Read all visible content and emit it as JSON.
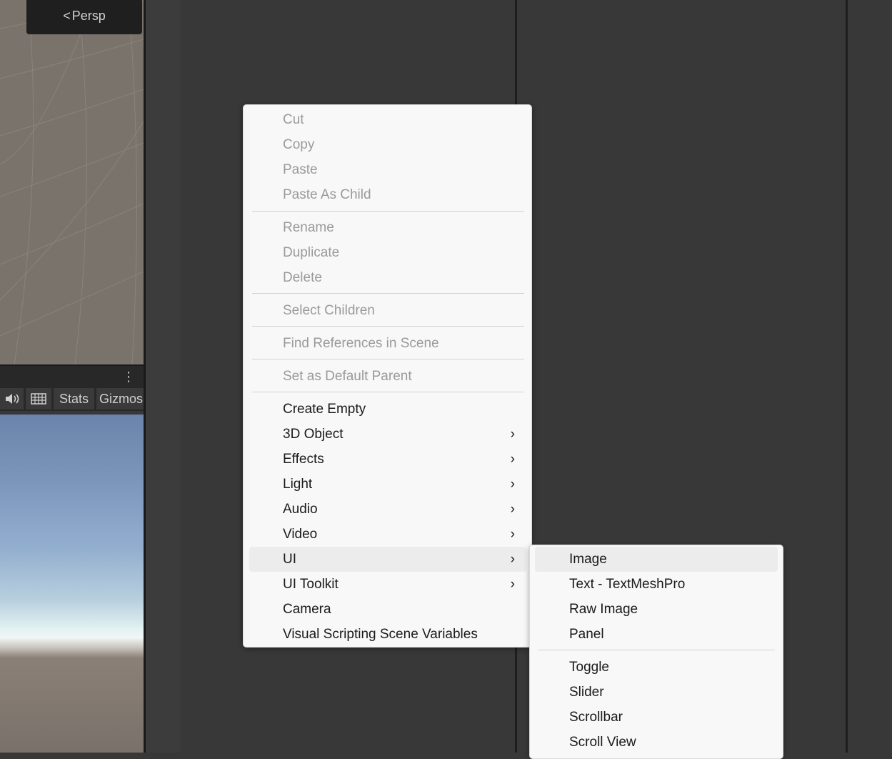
{
  "scene": {
    "perspective_label": "Persp",
    "perspective_icon": "back-arrow-icon"
  },
  "game_toolbar": {
    "audio_icon": "speaker-icon",
    "grid_icon": "grid-icon",
    "stats_label": "Stats",
    "gizmos_label": "Gizmos",
    "menu_icon": "kebab-menu-icon"
  },
  "context_menu": {
    "groups": [
      [
        "Cut",
        "Copy",
        "Paste",
        "Paste As Child"
      ],
      [
        "Rename",
        "Duplicate",
        "Delete"
      ],
      [
        "Select Children"
      ],
      [
        "Find References in Scene"
      ],
      [
        "Set as Default Parent"
      ]
    ],
    "create": {
      "create_empty": "Create Empty",
      "object_3d": "3D Object",
      "effects": "Effects",
      "light": "Light",
      "audio": "Audio",
      "video": "Video",
      "ui": "UI",
      "ui_toolkit": "UI Toolkit",
      "camera": "Camera",
      "visual_scripting": "Visual Scripting Scene Variables"
    },
    "highlighted": "UI"
  },
  "ui_submenu": {
    "image": "Image",
    "text_tmp": "Text - TextMeshPro",
    "raw_image": "Raw Image",
    "panel": "Panel",
    "toggle": "Toggle",
    "slider": "Slider",
    "scrollbar": "Scrollbar",
    "scroll_view": "Scroll View",
    "highlighted": "Image"
  },
  "colors": {
    "editor_bg": "#383838",
    "menu_bg": "#f8f8f8",
    "menu_hover": "#ececec",
    "disabled_text": "#9a9a9a"
  }
}
